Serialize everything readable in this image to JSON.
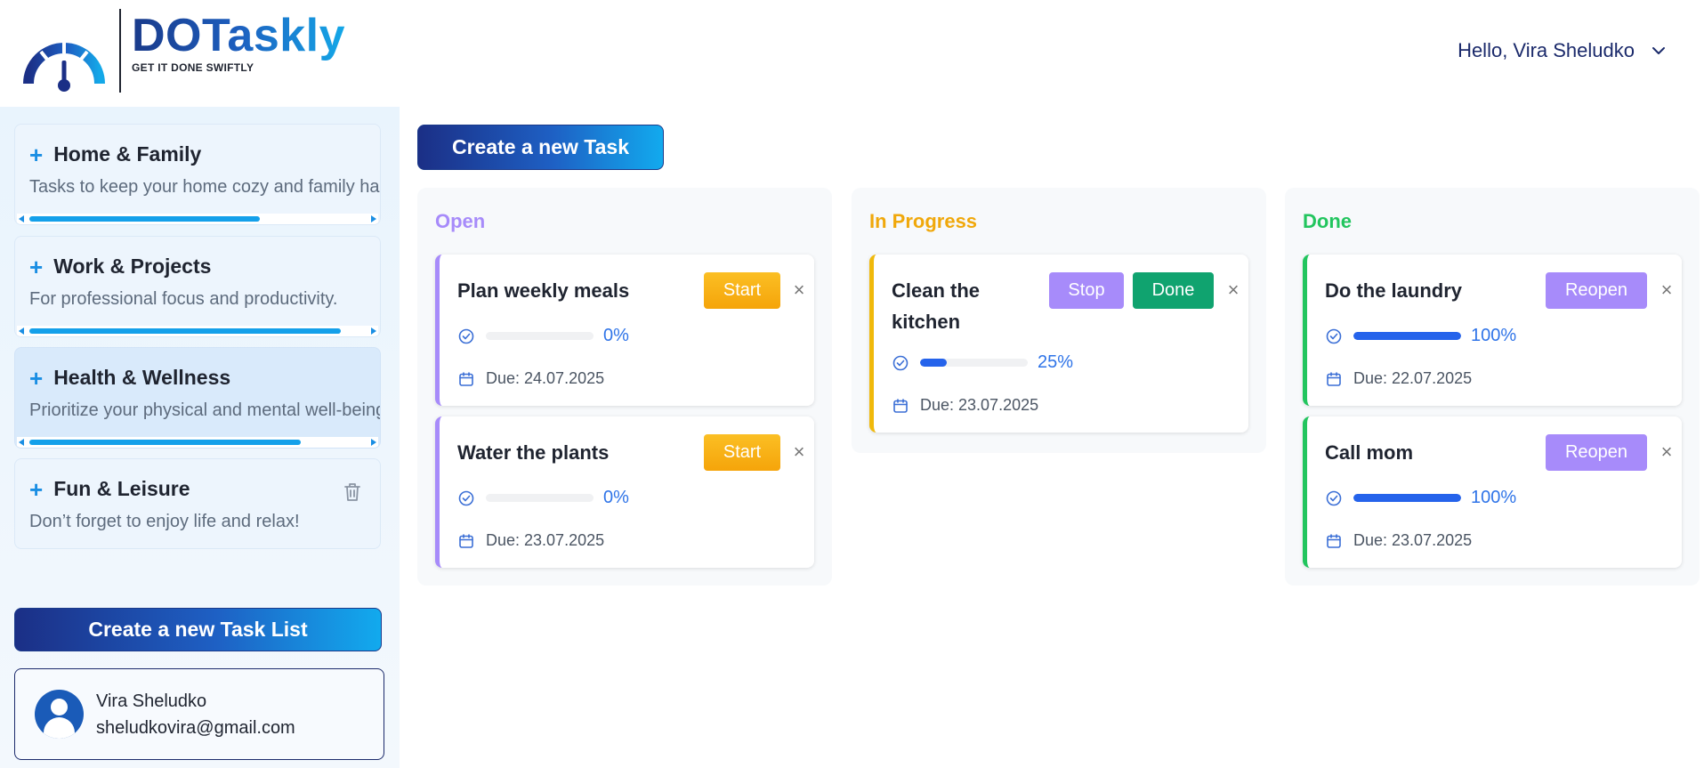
{
  "brand": {
    "name": "DOTaskly",
    "tagline": "GET IT DONE SWIFTLY"
  },
  "header": {
    "greeting": "Hello, Vira Sheludko"
  },
  "sidebar": {
    "lists": [
      {
        "title": "Home & Family",
        "description": "Tasks to keep your home cozy and family happy.",
        "scroll_fraction": 0.62
      },
      {
        "title": "Work & Projects",
        "description": "For professional focus and productivity.",
        "scroll_fraction": 0.85
      },
      {
        "title": "Health & Wellness",
        "description": "Prioritize your physical and mental well-being.",
        "scroll_fraction": 0.74
      },
      {
        "title": "Fun & Leisure",
        "description": "Don’t forget to enjoy life and relax!"
      }
    ],
    "create_list_label": "Create a new Task List",
    "profile": {
      "name": "Vira Sheludko",
      "email": "sheludkovira@gmail.com"
    }
  },
  "main": {
    "create_task_label": "Create a new Task",
    "columns": [
      {
        "title": "Open",
        "color": "#a78bfa",
        "tasks": [
          {
            "title": "Plan weekly meals",
            "action": "Start",
            "progress": 0,
            "progress_label": "0%",
            "due": "Due: 24.07.2025"
          },
          {
            "title": "Water the plants",
            "action": "Start",
            "progress": 0,
            "progress_label": "0%",
            "due": "Due: 23.07.2025"
          }
        ]
      },
      {
        "title": "In Progress",
        "color": "#f0a80b",
        "tasks": [
          {
            "title": "Clean the kitchen",
            "actions": [
              "Stop",
              "Done"
            ],
            "progress": 25,
            "progress_label": "25%",
            "due": "Due: 23.07.2025"
          }
        ]
      },
      {
        "title": "Done",
        "color": "#22c55e",
        "tasks": [
          {
            "title": "Do the laundry",
            "action": "Reopen",
            "progress": 100,
            "progress_label": "100%",
            "due": "Due: 22.07.2025"
          },
          {
            "title": "Call mom",
            "action": "Reopen",
            "progress": 100,
            "progress_label": "100%",
            "due": "Due: 23.07.2025"
          }
        ]
      }
    ],
    "close_symbol": "×"
  },
  "icons": {
    "logo": "speedometer-icon",
    "chevron": "chevron-down-icon",
    "trash": "trash-icon",
    "progress": "check-circle-icon",
    "due": "calendar-icon",
    "avatar": "user-avatar-icon"
  }
}
